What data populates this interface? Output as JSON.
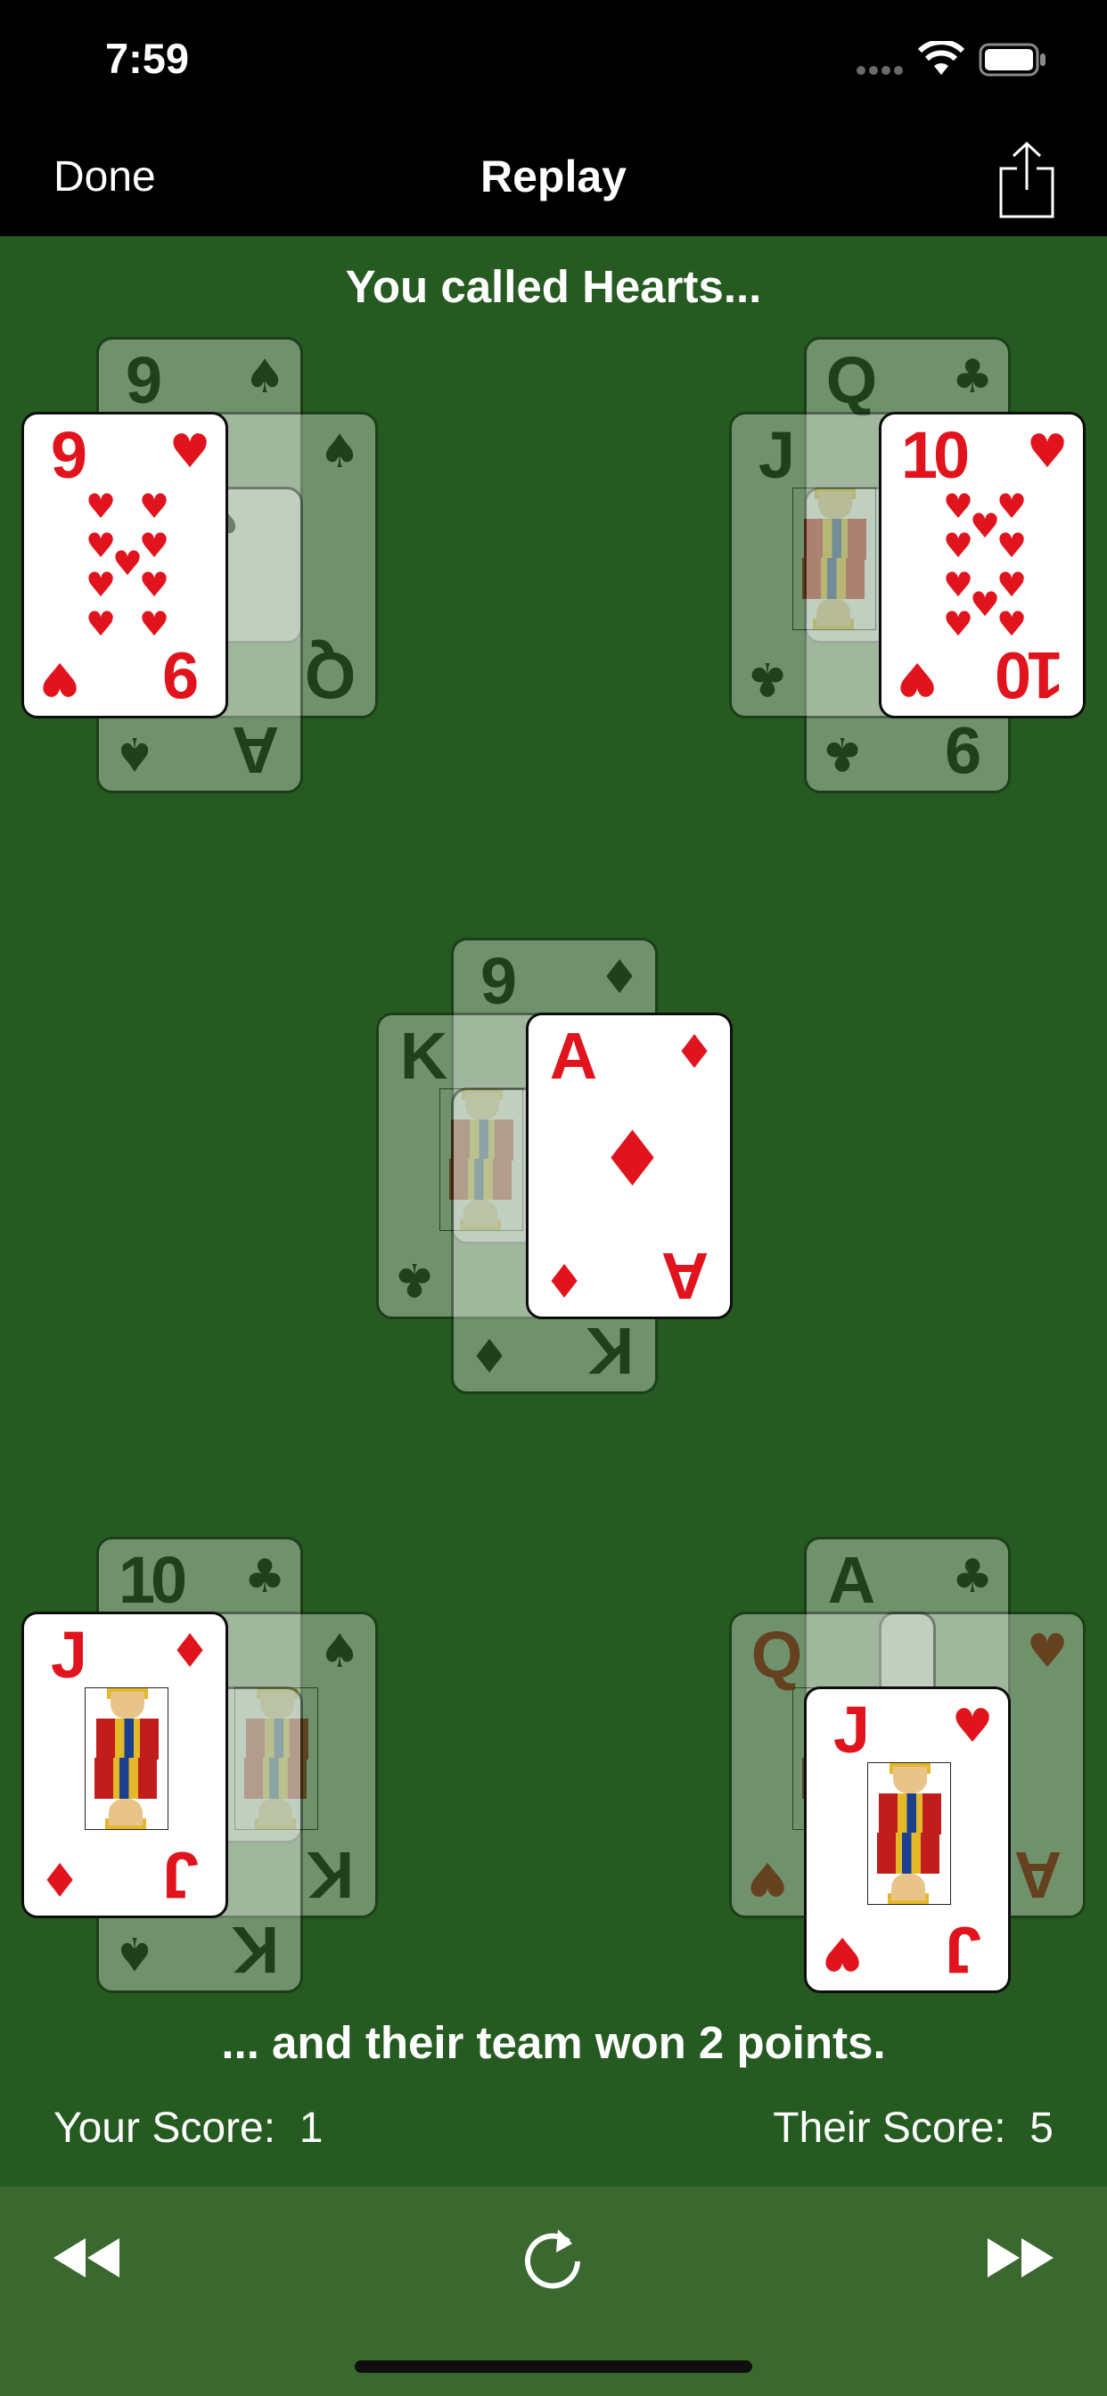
{
  "status": {
    "time": "7:59"
  },
  "nav": {
    "done_label": "Done",
    "title": "Replay",
    "share_icon": "share-icon"
  },
  "messages": {
    "top": "You called Hearts...",
    "bottom": "... and their team won 2 points."
  },
  "scores": {
    "yours_label": "Your Score:",
    "yours_value": "1",
    "theirs_label": "Their Score:",
    "theirs_value": "5"
  },
  "cards": {
    "top_left_back1": {
      "rank": "9",
      "suit": "♠",
      "color": "black"
    },
    "top_left_back2": {
      "rank": "Q",
      "suit": "♠",
      "color": "black"
    },
    "top_left_mid": {
      "rank": "A",
      "suit": "♠",
      "color": "black"
    },
    "top_left_front": {
      "rank": "9",
      "suit": "♥",
      "color": "red"
    },
    "top_right_back1": {
      "rank": "Q",
      "suit": "♣",
      "color": "black"
    },
    "top_right_back2": {
      "rank": "9",
      "suit": "♣",
      "color": "black"
    },
    "top_right_mid": {
      "rank": "J",
      "suit": "♣",
      "color": "black"
    },
    "top_right_front": {
      "rank": "10",
      "suit": "♥",
      "color": "red"
    },
    "center_back1": {
      "rank": "9",
      "suit": "♦",
      "color": "red"
    },
    "center_back2": {
      "rank": "K",
      "suit": "♣",
      "color": "black"
    },
    "center_back3": {
      "rank": "K",
      "suit": "♦",
      "color": "red"
    },
    "center_front": {
      "rank": "A",
      "suit": "♦",
      "color": "red"
    },
    "bottom_left_back1": {
      "rank": "10",
      "suit": "♣",
      "color": "black"
    },
    "bottom_left_back2": {
      "rank": "K",
      "suit": "♠",
      "color": "black"
    },
    "bottom_left_back3": {
      "rank": "K",
      "suit": "♠",
      "color": "black"
    },
    "bottom_left_front": {
      "rank": "J",
      "suit": "♦",
      "color": "red"
    },
    "bottom_right_back1": {
      "rank": "A",
      "suit": "♣",
      "color": "black"
    },
    "bottom_right_back2": {
      "rank": "A",
      "suit": "♥",
      "color": "red"
    },
    "bottom_right_mid": {
      "rank": "Q",
      "suit": "♥",
      "color": "red"
    },
    "bottom_right_front": {
      "rank": "J",
      "suit": "♥",
      "color": "red"
    }
  },
  "toolbar": {
    "rewind_icon": "rewind-icon",
    "replay_icon": "replay-icon",
    "fast_forward_icon": "fast-forward-icon"
  },
  "colors": {
    "felt": "#255a20",
    "toolbar": "#3a682f",
    "red_suit": "#e1141e"
  }
}
